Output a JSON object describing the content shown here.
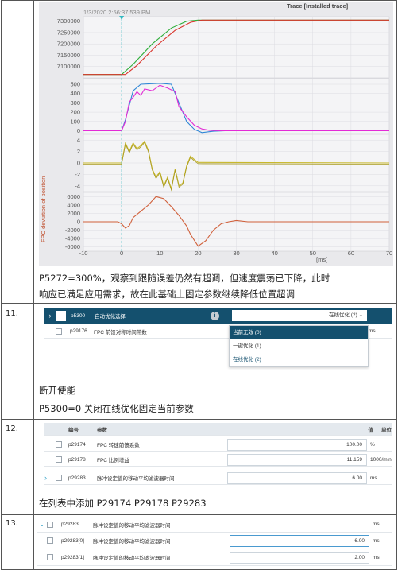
{
  "rows": [
    {
      "number": "",
      "chart": {
        "header_timestamp": "1/3/2020 2:56:37.539 PM",
        "header_title": "Trace [Installed trace]",
        "y_axis_label": "FPC deviation of position",
        "x_unit": "[ms]"
      },
      "caption": [
        "P5272=300%，观察到跟随误差仍然有超调，但速度震荡已下降，此时",
        "响应已满足应用需求，故在此基础上固定参数继续降低位置超调"
      ]
    },
    {
      "number": "11.",
      "ui": {
        "selected_param": "p5300",
        "selected_name": "自动优化选择",
        "selected_value": "在线优化 (2)",
        "second_param": "p29176",
        "second_name": "FPC 前馈对称时间常数",
        "second_unit": "ms",
        "dropdown_options": [
          "当前无效 (0)",
          "一键优化 (1)",
          "在线优化 (2)"
        ]
      },
      "caption": [
        "断开使能",
        "P5300=0 关闭在线优化固定当前参数"
      ]
    },
    {
      "number": "12.",
      "ui": {
        "headers": {
          "id": "编号",
          "param": "参数",
          "value": "值",
          "unit": "单位"
        },
        "params": [
          {
            "id": "p29174",
            "name": "FPC 转速前馈系数",
            "value": "100.00",
            "unit": "%"
          },
          {
            "id": "p29178",
            "name": "FPC 比例增益",
            "value": "11.159",
            "unit": "1000/min"
          },
          {
            "id": "p29283",
            "name": "脉冲设定值的移动平均滤波器时间",
            "value": "6.00",
            "unit": "ms"
          }
        ]
      },
      "caption": [
        "在列表中添加 P29174 P29178 P29283"
      ]
    },
    {
      "number": "13.",
      "ui": {
        "params": [
          {
            "id": "p29283",
            "name": "脉冲设定值的移动平均滤波器时间",
            "value": "",
            "unit": "ms"
          },
          {
            "id": "p29283[0]",
            "name": "脉冲设定值的移动平均滤波器时间",
            "value": "6.00",
            "unit": "ms"
          },
          {
            "id": "p29283[1]",
            "name": "脉冲设定值的移动平均滤波器时间",
            "value": "2.00",
            "unit": "ms"
          }
        ]
      }
    }
  ],
  "chart_data": {
    "type": "line",
    "x_range": [
      -10,
      70
    ],
    "x_ticks": [
      "-10",
      "0",
      "10",
      "20",
      "30",
      "40",
      "50",
      "60",
      "70"
    ],
    "x_unit": "[ms]",
    "panels": [
      {
        "y_ticks": [
          "7300000",
          "7250000",
          "7200000",
          "7150000",
          "7100000"
        ],
        "y_range": [
          7050000,
          7320000
        ],
        "series": [
          {
            "color": "#2fae3a",
            "x": [
              -10,
              0,
              3,
              8,
              13,
              17,
              20,
              70
            ],
            "y": [
              7065000,
              7065000,
              7110000,
              7200000,
              7270000,
              7300000,
              7305000,
              7305000
            ]
          },
          {
            "color": "#d9342b",
            "x": [
              -10,
              1,
              4,
              9,
              14,
              18,
              21,
              70
            ],
            "y": [
              7065000,
              7065000,
              7105000,
              7190000,
              7260000,
              7295000,
              7305000,
              7305000
            ]
          }
        ]
      },
      {
        "y_ticks": [
          "500",
          "400",
          "300",
          "200",
          "100",
          "0"
        ],
        "y_range": [
          -30,
          560
        ],
        "series": [
          {
            "color": "#2f86d6",
            "x": [
              -10,
              0,
              1,
              3,
              5,
              10,
              13,
              15,
              17,
              19,
              21,
              24,
              27,
              30,
              70
            ],
            "y": [
              0,
              0,
              120,
              430,
              500,
              510,
              500,
              300,
              100,
              15,
              -20,
              -5,
              0,
              0,
              0
            ]
          },
          {
            "color": "#e32bd6",
            "x": [
              -10,
              0,
              1,
              2,
              3,
              4,
              5,
              6,
              8,
              10,
              12,
              14,
              15,
              17,
              19,
              21,
              23,
              26,
              30,
              70
            ],
            "y": [
              0,
              0,
              100,
              310,
              360,
              420,
              380,
              450,
              430,
              490,
              460,
              420,
              260,
              150,
              60,
              20,
              5,
              0,
              0,
              0
            ]
          }
        ]
      },
      {
        "y_ticks": [
          "4",
          "2",
          "0",
          "-2",
          "-4"
        ],
        "y_range": [
          -5,
          5
        ],
        "series": [
          {
            "color": "#c8b82c",
            "x": [
              -10,
              0,
              1,
              2,
              3,
              4,
              5,
              6,
              7,
              8,
              9,
              10,
              11,
              12,
              13,
              14,
              15,
              16,
              17,
              18,
              19,
              20,
              70
            ],
            "y": [
              0,
              0,
              3.5,
              2.0,
              3.5,
              2.5,
              3.0,
              3.8,
              2.2,
              -1.0,
              -2.5,
              -1.5,
              -4.0,
              -2.5,
              -4.5,
              -1.0,
              -4.0,
              -3.5,
              -0.5,
              1.2,
              0.6,
              0.1,
              0
            ]
          }
        ]
      },
      {
        "y_ticks": [
          "6000",
          "4000",
          "2000",
          "0",
          "-2000",
          "-4000",
          "-6000"
        ],
        "y_range": [
          -7000,
          7000
        ],
        "series": [
          {
            "color": "#d0603b",
            "x": [
              -10,
              -1,
              0,
              1,
              2,
              3,
              5,
              7,
              9,
              11,
              13,
              15,
              17,
              18,
              20,
              22,
              24,
              26,
              28,
              30,
              33,
              70
            ],
            "y": [
              0,
              0,
              -500,
              -1500,
              -900,
              1000,
              2500,
              4000,
              6000,
              5500,
              3600,
              1500,
              -1000,
              -3000,
              -5800,
              -4500,
              -2000,
              -500,
              0,
              300,
              0,
              0
            ]
          }
        ]
      }
    ]
  }
}
